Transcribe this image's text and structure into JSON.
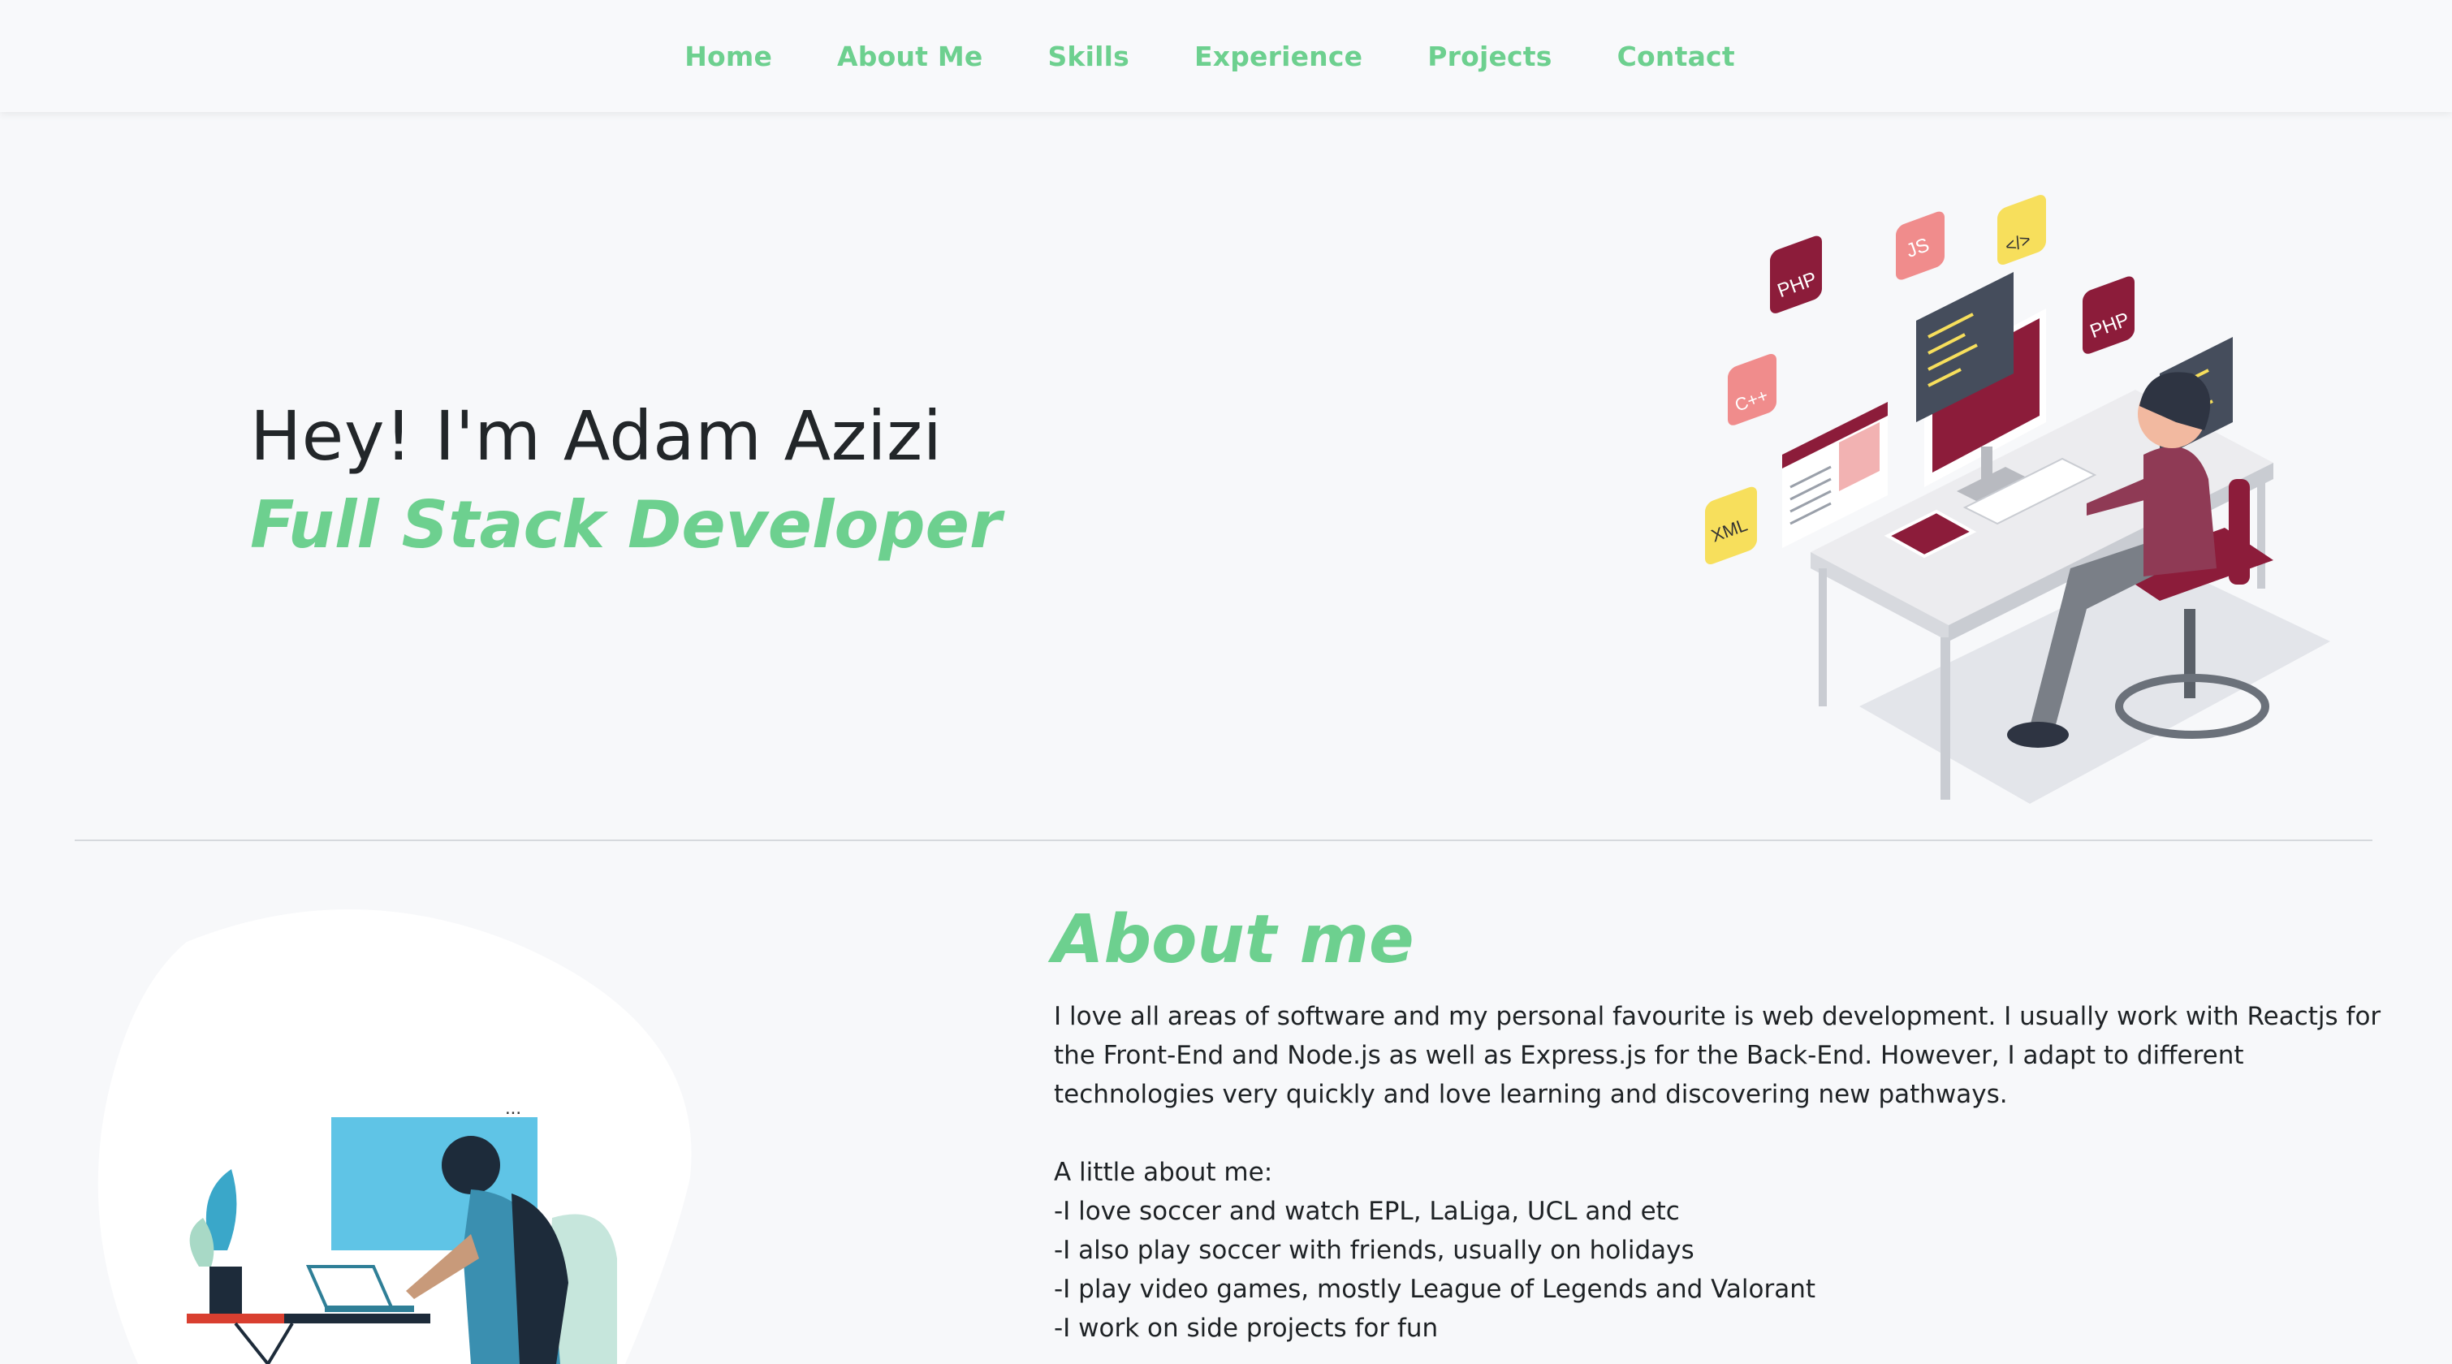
{
  "nav": {
    "items": [
      {
        "label": "Home"
      },
      {
        "label": "About Me"
      },
      {
        "label": "Skills"
      },
      {
        "label": "Experience"
      },
      {
        "label": "Projects"
      },
      {
        "label": "Contact"
      }
    ]
  },
  "hero": {
    "greeting": "Hey! I'm Adam Azizi",
    "role": "Full Stack Developer",
    "badges": {
      "php_left": "PHP",
      "js": "JS",
      "code": "</>",
      "php_right": "PHP",
      "cpp": "C++",
      "xml": "XML"
    }
  },
  "about": {
    "heading": "About me",
    "intro": "I love all areas of software and my personal favourite is web development. I usually work with Reactjs for the Front-End and Node.js as well as Express.js for the Back-End. However, I adapt to different technologies very quickly and love learning and discovering new pathways.",
    "list_title": "A little about me:",
    "items": [
      "-I love soccer and watch EPL, LaLiga, UCL and etc",
      "-I also play soccer with friends, usually on holidays",
      "-I play video games, mostly League of Legends and Valorant",
      "-I work on side projects for fun"
    ],
    "dots": "..."
  },
  "colors": {
    "accent": "#6dd08f",
    "text": "#222629",
    "background": "#f7f8fa",
    "maroon": "#8c1c3a",
    "pink": "#f08c8c",
    "yellow": "#f7df5c"
  }
}
